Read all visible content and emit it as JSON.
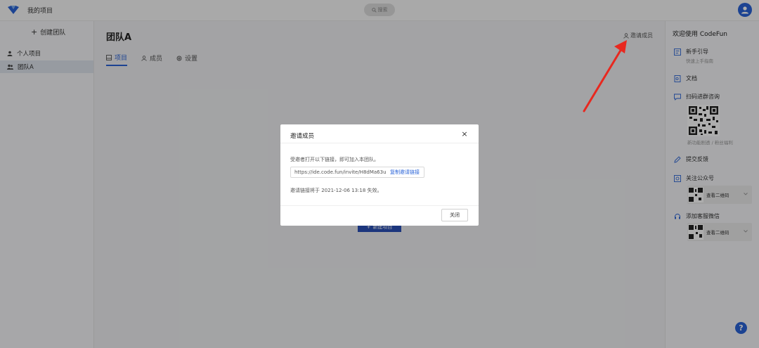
{
  "app": {
    "title": "我的项目",
    "search_label": "搜索"
  },
  "sidebar_left": {
    "create_team": "创建团队",
    "items": [
      {
        "label": "个人项目"
      },
      {
        "label": "团队A"
      }
    ]
  },
  "main": {
    "team_name": "团队A",
    "invite_member": "邀请成员",
    "tabs": [
      {
        "label": "项目"
      },
      {
        "label": "成员"
      },
      {
        "label": "设置"
      }
    ],
    "new_project": "新建项目"
  },
  "sidebar_right": {
    "welcome": "欢迎使用 CodeFun",
    "guide_title": "新手引导",
    "guide_sub": "快速上手指南",
    "docs": "文档",
    "scan_group": "扫码进群咨询",
    "qr_caption": "新功能剧透 / 粉丝福利",
    "feedback": "提交反馈",
    "follow": "关注公众号",
    "view_qr_1": "查看二维码",
    "add_service": "添加客服微信",
    "view_qr_2": "查看二维码"
  },
  "modal": {
    "title": "邀请成员",
    "description": "受邀者打开以下链接，即可加入本团队。",
    "link": "https://ide.code.fun/invite/H8dMa63u",
    "copy_label": "复制邀请链接",
    "expire_note": "邀请链接将于 2021-12-06 13:18 失效。",
    "close_label": "关闭"
  },
  "colors": {
    "accent": "#2a64d8",
    "annotation": "#e8281f"
  }
}
